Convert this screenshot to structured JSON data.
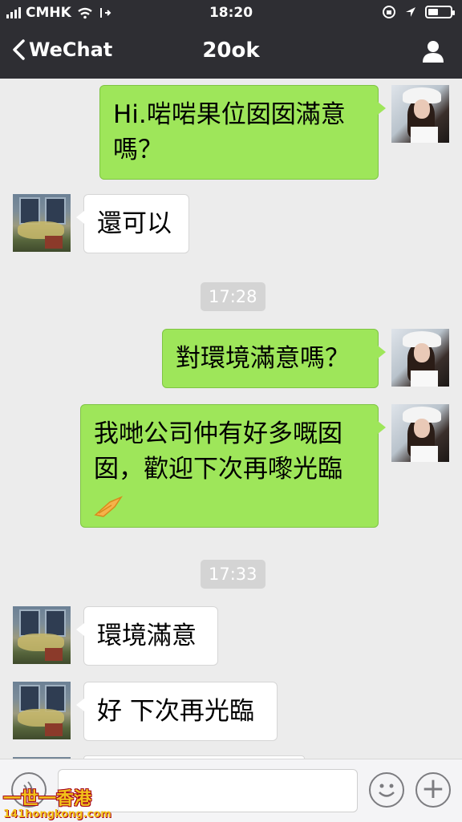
{
  "status_bar": {
    "carrier": "CMHK",
    "time": "18:20",
    "battery_level": 0.45
  },
  "nav": {
    "back_label": "WeChat",
    "title": "20ok"
  },
  "messages": [
    {
      "side": "right",
      "text": "Hi.啱啱果位囡囡滿意嗎？"
    },
    {
      "side": "left",
      "text": "還可以"
    },
    {
      "type": "time",
      "text": "17:28"
    },
    {
      "side": "right",
      "text": "對環境滿意嗎？"
    },
    {
      "side": "right",
      "text": "我哋公司仲有好多嘅囡囡，歡迎下次再嚟光臨"
    },
    {
      "type": "time",
      "text": "17:33"
    },
    {
      "side": "left",
      "text": "環境滿意"
    },
    {
      "side": "left",
      "text": "好 下次再光臨"
    }
  ],
  "input_bar": {
    "text": ""
  },
  "watermark": {
    "line1": "一世一香港",
    "line2": "141hongkong.com"
  },
  "colors": {
    "topbar": "#2e2e33",
    "chat_bg": "#ececec",
    "green_bubble": "#9ee65a",
    "white_bubble": "#ffffff"
  }
}
